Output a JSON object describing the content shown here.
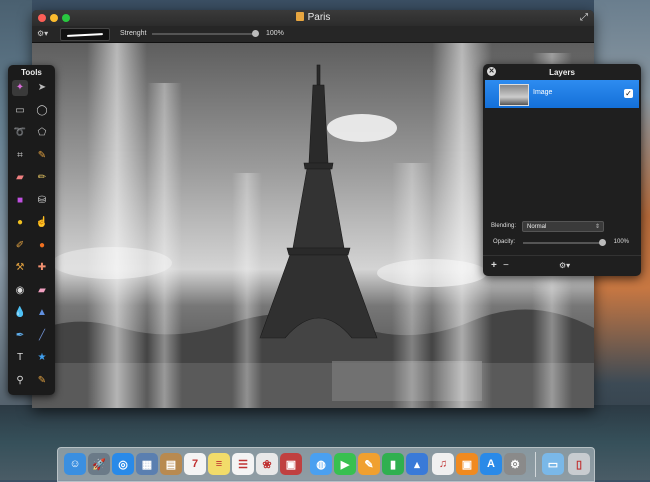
{
  "window": {
    "title": "Paris"
  },
  "options_bar": {
    "strength_label": "Strenght",
    "strength_value": "100%",
    "strength_level": 1.0
  },
  "tools_panel": {
    "title": "Tools",
    "tools": [
      {
        "name": "magic-wand-tool-icon",
        "glyph": "✦",
        "color": "#d86bd8"
      },
      {
        "name": "move-tool-icon",
        "glyph": "➤",
        "color": "#bbbbbb"
      },
      {
        "name": "rect-select-tool-icon",
        "glyph": "▭",
        "color": "#cccccc"
      },
      {
        "name": "ellipse-select-tool-icon",
        "glyph": "◯",
        "color": "#cccccc"
      },
      {
        "name": "lasso-tool-icon",
        "glyph": "➰",
        "color": "#cccccc"
      },
      {
        "name": "polygon-lasso-tool-icon",
        "glyph": "⬠",
        "color": "#cccccc"
      },
      {
        "name": "crop-tool-icon",
        "glyph": "⌗",
        "color": "#cccccc"
      },
      {
        "name": "eyedropper-tool-icon",
        "glyph": "✎",
        "color": "#e0a040"
      },
      {
        "name": "eraser-tool-icon",
        "glyph": "▰",
        "color": "#f08080"
      },
      {
        "name": "pencil-tool-icon",
        "glyph": "✏",
        "color": "#e0c060"
      },
      {
        "name": "gradient-tool-icon",
        "glyph": "■",
        "color": "#c050e0"
      },
      {
        "name": "paint-bucket-tool-icon",
        "glyph": "⛁",
        "color": "#dddddd"
      },
      {
        "name": "clone-tool-icon",
        "glyph": "●",
        "color": "#f0c020"
      },
      {
        "name": "smudge-tool-icon",
        "glyph": "☝",
        "color": "#dddddd"
      },
      {
        "name": "brush-tool-icon",
        "glyph": "✐",
        "color": "#e0a040"
      },
      {
        "name": "burn-tool-icon",
        "glyph": "●",
        "color": "#f07020"
      },
      {
        "name": "stamp-tool-icon",
        "glyph": "⚒",
        "color": "#e0a040"
      },
      {
        "name": "heal-tool-icon",
        "glyph": "✚",
        "color": "#f09070"
      },
      {
        "name": "red-eye-tool-icon",
        "glyph": "◉",
        "color": "#dddddd"
      },
      {
        "name": "sponge-tool-icon",
        "glyph": "▰",
        "color": "#f0a0c0"
      },
      {
        "name": "blur-tool-icon",
        "glyph": "💧",
        "color": "#60a0e0"
      },
      {
        "name": "sharpen-tool-icon",
        "glyph": "▲",
        "color": "#6090e0"
      },
      {
        "name": "pen-tool-icon",
        "glyph": "✒",
        "color": "#60b0f0"
      },
      {
        "name": "line-tool-icon",
        "glyph": "╱",
        "color": "#7090d0"
      },
      {
        "name": "text-tool-icon",
        "glyph": "T",
        "color": "#dddddd"
      },
      {
        "name": "shape-tool-icon",
        "glyph": "★",
        "color": "#40a0f0"
      },
      {
        "name": "zoom-tool-icon",
        "glyph": "⚲",
        "color": "#dddddd"
      },
      {
        "name": "color-picker-tool-icon",
        "glyph": "✎",
        "color": "#e0a040"
      }
    ]
  },
  "layers_panel": {
    "title": "Layers",
    "layers": [
      {
        "name": "Image",
        "visible": true
      }
    ],
    "blending_label": "Blending:",
    "blending_value": "Normal",
    "opacity_label": "Opacity:",
    "opacity_value": "100%",
    "opacity_level": 1.0
  },
  "dock": {
    "apps": [
      {
        "name": "finder-icon",
        "glyph": "☺",
        "bg": "#3b8fe0"
      },
      {
        "name": "launchpad-icon",
        "glyph": "🚀",
        "bg": "#6b7a88"
      },
      {
        "name": "safari-icon",
        "glyph": "◎",
        "bg": "#2a8ae8"
      },
      {
        "name": "photo-app-icon",
        "glyph": "▦",
        "bg": "#5a7fb0"
      },
      {
        "name": "contacts-icon",
        "glyph": "▤",
        "bg": "#b88a50"
      },
      {
        "name": "calendar-icon",
        "glyph": "7",
        "bg": "#f4f4f4"
      },
      {
        "name": "notes-icon",
        "glyph": "≡",
        "bg": "#f2dc6a"
      },
      {
        "name": "reminders-icon",
        "glyph": "☰",
        "bg": "#f4f4f4"
      },
      {
        "name": "photos-icon",
        "glyph": "❀",
        "bg": "#e8e8e8"
      },
      {
        "name": "photo-booth-icon",
        "glyph": "▣",
        "bg": "#c04040"
      },
      {
        "name": "messages-icon",
        "glyph": "◍",
        "bg": "#4aa0f0"
      },
      {
        "name": "facetime-icon",
        "glyph": "▶",
        "bg": "#38c050"
      },
      {
        "name": "pages-icon",
        "glyph": "✎",
        "bg": "#f0a030"
      },
      {
        "name": "numbers-icon",
        "glyph": "▮",
        "bg": "#30b050"
      },
      {
        "name": "keynote-icon",
        "glyph": "▴",
        "bg": "#3a7ad8"
      },
      {
        "name": "itunes-icon",
        "glyph": "♫",
        "bg": "#f0f0f0"
      },
      {
        "name": "ibooks-icon",
        "glyph": "▣",
        "bg": "#f08a20"
      },
      {
        "name": "app-store-icon",
        "glyph": "A",
        "bg": "#2a8ae8"
      },
      {
        "name": "system-preferences-icon",
        "glyph": "⚙",
        "bg": "#8a8a8a"
      },
      {
        "name": "downloads-folder-icon",
        "glyph": "▭",
        "bg": "#7ab8e8"
      },
      {
        "name": "trash-icon",
        "glyph": "▯",
        "bg": "#c8ccd0"
      }
    ]
  },
  "colors": {
    "selection": "#1a7ee6",
    "panel_bg": "#1f1f1f",
    "close": "#fc5f57",
    "minimize": "#fdbc2e",
    "zoom": "#29c840"
  }
}
